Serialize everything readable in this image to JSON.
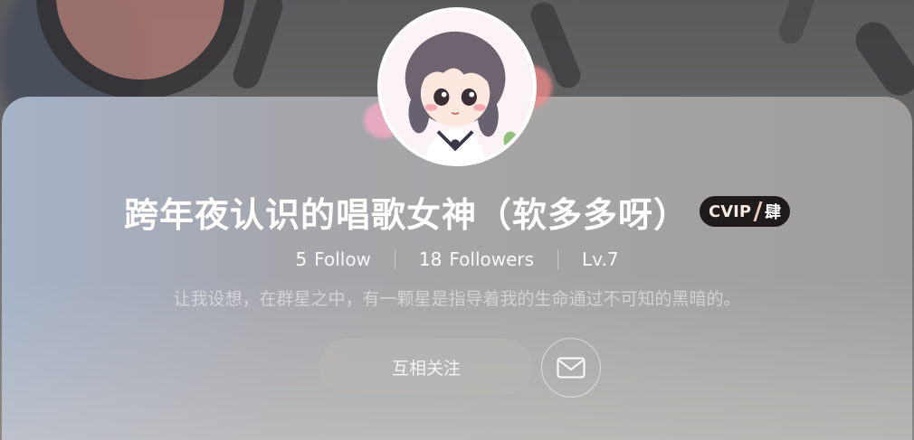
{
  "profile": {
    "username": "跨年夜认识的唱歌女神（软多多呀）",
    "vip_badge": {
      "mark": "CVIP",
      "level": "肆"
    },
    "stats": {
      "follow_count": "5",
      "follow_label": "Follow",
      "followers_count": "18",
      "followers_label": "Followers",
      "level": "Lv.7"
    },
    "bio": "让我设想，在群星之中，有一颗星是指导着我的生命通过不可知的黑暗的。"
  },
  "actions": {
    "follow_label": "互相关注",
    "message_icon": "mail-icon"
  },
  "colors": {
    "vip_badge_bg": "#1f1b1a",
    "card_tint_left": "#a6b2c8",
    "card_tint_right": "#a09e9c"
  }
}
